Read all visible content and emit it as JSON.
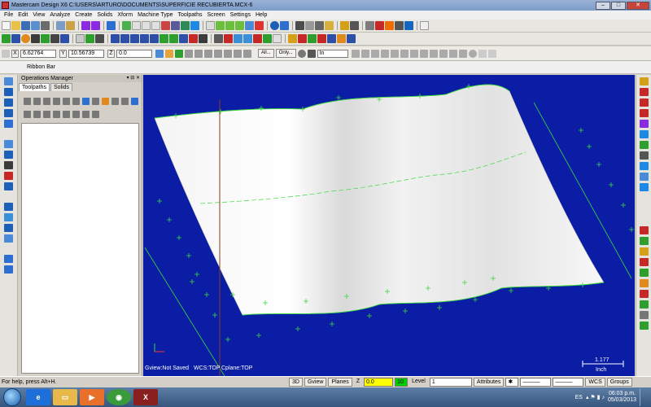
{
  "window": {
    "title": "Mastercam Design X6  C:\\USERS\\ARTURO\\DOCUMENTS\\SUPERFICIE RECUBIERTA.MCX-6",
    "minimize": "–",
    "maximize": "□",
    "close": "✕"
  },
  "menus": [
    "File",
    "Edit",
    "View",
    "Analyze",
    "Create",
    "Solids",
    "Xform",
    "Machine Type",
    "Toolpaths",
    "Screen",
    "Settings",
    "Help"
  ],
  "ribbon": {
    "x_label": "X",
    "x_value": "6.62764",
    "y_label": "Y",
    "y_value": "10.56739",
    "z_label": "Z",
    "z_value": "0.0",
    "all_button": "All...",
    "only_button": "Only...",
    "in_select": "In"
  },
  "ribbon_bar_label": "Ribbon Bar",
  "ops_manager": {
    "title": "Operations Manager",
    "tabs": [
      "Toolpaths",
      "Solids"
    ]
  },
  "viewport": {
    "gview": "Gview:Not Saved",
    "wcs": "WCS:TOP",
    "cplane": "Cplane:TOP",
    "scale_value": "1.177",
    "scale_unit": "Inch"
  },
  "status": {
    "help_text": "For help, press Alt+H.",
    "btn_3d": "3D",
    "btn_gview": "Gview",
    "btn_planes": "Planes",
    "z_label": "Z",
    "z_value": "0.0",
    "level_value": "10",
    "level_label": "Level",
    "level_field": "1",
    "attributes_label": "Attributes",
    "wcs_label": "WCS",
    "groups_label": "Groups"
  },
  "taskbar": {
    "lang": "ES",
    "time": "06:03 p.m.",
    "date": "05/03/2013"
  },
  "colors": {
    "viewport_bg": "#0a1da4",
    "surface": "#ececec",
    "wireframe": "#3adb3a",
    "z_field": "#ffff00",
    "level_field": "#00cc00"
  }
}
